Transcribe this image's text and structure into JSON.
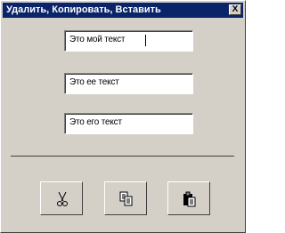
{
  "window": {
    "title": "Удалить, Копировать, Вставить",
    "close_label": "X"
  },
  "fields": [
    {
      "value": "Это мой текст"
    },
    {
      "value": "Это ее текст"
    },
    {
      "value": "Это его текст"
    }
  ],
  "toolbar": {
    "buttons": [
      {
        "icon": "scissors-icon",
        "action": "cut"
      },
      {
        "icon": "copy-icon",
        "action": "copy"
      },
      {
        "icon": "paste-icon",
        "action": "paste"
      }
    ]
  },
  "colors": {
    "titlebar": "#0a246a",
    "face": "#d4d0c8"
  }
}
